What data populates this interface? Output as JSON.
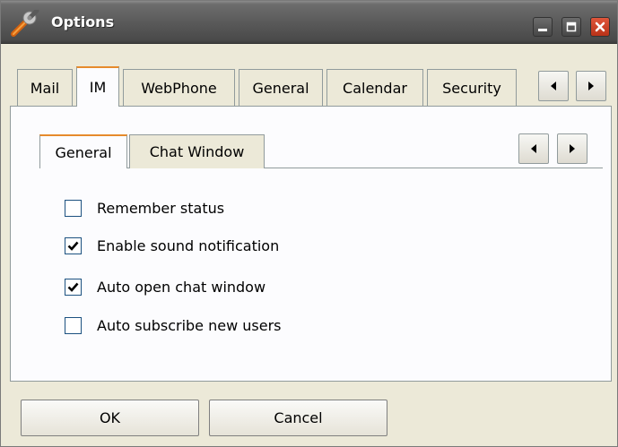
{
  "window": {
    "title": "Options",
    "title_icon": "wrench-icon",
    "controls": [
      "minimize-icon",
      "maximize-icon",
      "close-icon"
    ]
  },
  "tabs": [
    {
      "label": "Mail",
      "active": false
    },
    {
      "label": "IM",
      "active": true
    },
    {
      "label": "WebPhone",
      "active": false
    },
    {
      "label": "General",
      "active": false
    },
    {
      "label": "Calendar",
      "active": false
    },
    {
      "label": "Security",
      "active": false
    }
  ],
  "sub_tabs": [
    {
      "label": "General",
      "active": true
    },
    {
      "label": "Chat Window",
      "active": false
    }
  ],
  "options": [
    {
      "label": "Remember status",
      "checked": false
    },
    {
      "label": "Enable sound notification",
      "checked": true
    },
    {
      "label": "Auto open chat window",
      "checked": true
    },
    {
      "label": "Auto subscribe new users",
      "checked": false
    }
  ],
  "buttons": {
    "ok": "OK",
    "cancel": "Cancel"
  },
  "colors": {
    "titlebar": "#4a4a4a",
    "active_tab_accent": "#e68b2c",
    "close_button": "#c8391f",
    "dialog_bg": "#ece9d8"
  }
}
